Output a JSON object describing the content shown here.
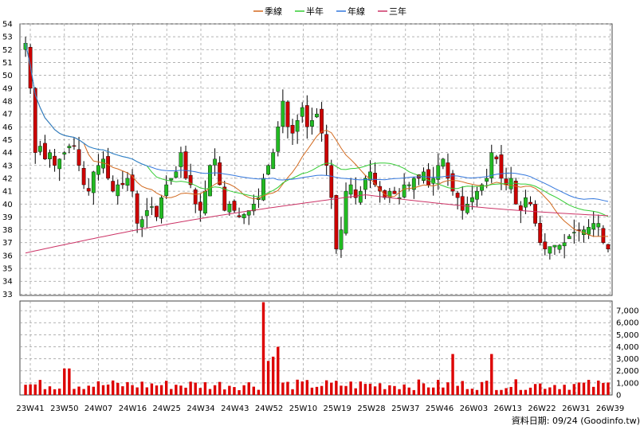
{
  "chart_data": {
    "type": "candlestick-with-volume",
    "legend": [
      {
        "label": "季線",
        "color": "#d2691e"
      },
      {
        "label": "半年",
        "color": "#33cc33"
      },
      {
        "label": "年線",
        "color": "#3377dd"
      },
      {
        "label": "三年",
        "color": "#cc3366"
      }
    ],
    "price_axis": {
      "ticks": [
        33,
        34,
        35,
        36,
        37,
        38,
        39,
        40,
        41,
        42,
        43,
        44,
        45,
        46,
        47,
        48,
        49,
        50,
        51,
        52,
        53,
        54
      ],
      "ylim": [
        32.9,
        54
      ]
    },
    "volume_axis": {
      "ticks": [
        "0",
        "1,000",
        "2,000",
        "3,000",
        "4,000",
        "5,000",
        "6,000",
        "7,000"
      ],
      "max": 7800
    },
    "x_tick_labels": [
      "23W41",
      "23W50",
      "24W07",
      "24W16",
      "24W25",
      "24W34",
      "24W43",
      "24W52",
      "25W10",
      "25W19",
      "25W28",
      "25W37",
      "25W46",
      "26W03",
      "26W13",
      "26W22",
      "26W31",
      "26W39"
    ],
    "colors": {
      "up": "#22bb22",
      "down": "#cc0000",
      "grid": "#999999",
      "volume": "#dd0000"
    },
    "footer": "資料日期: 09/24  (Goodinfo.tw)",
    "close": [
      52.5,
      49.0,
      44.0,
      44.5,
      43.5,
      44.0,
      43.0,
      43.5,
      44.0,
      44.5,
      44.5,
      43.0,
      41.5,
      41.0,
      42.5,
      43.0,
      43.5,
      42.0,
      41.0,
      41.5,
      41.5,
      42.0,
      41.0,
      38.5,
      38.8,
      39.5,
      39.8,
      39.0,
      40.5,
      41.5,
      42.0,
      42.5,
      44.0,
      42.0,
      41.5,
      40.0,
      39.5,
      41.0,
      43.0,
      43.5,
      41.5,
      39.5,
      40.0,
      39.5,
      39.0,
      39.2,
      39.5,
      40.0,
      40.5,
      42.0,
      43.0,
      44.0,
      46.0,
      48.0,
      46.0,
      45.5,
      46.5,
      47.5,
      46.0,
      46.5,
      47.0,
      45.5,
      43.0,
      40.5,
      36.5,
      38.0,
      41.0,
      41.5,
      40.5,
      41.0,
      42.0,
      42.5,
      41.5,
      41.0,
      40.5,
      41.0,
      40.8,
      40.5,
      41.5,
      41.5,
      42.0,
      42.0,
      42.5,
      41.5,
      42.0,
      43.0,
      43.5,
      42.0,
      41.0,
      40.5,
      39.5,
      40.0,
      40.5,
      41.0,
      41.5,
      42.0,
      44.0,
      43.5,
      42.0,
      41.5,
      42.0,
      40.0,
      39.5,
      40.5,
      40.0,
      38.5,
      37.0,
      36.5,
      36.7,
      36.8,
      36.8,
      37.0,
      37.5,
      37.8,
      38.0,
      38.0,
      38.2,
      38.5,
      38.5,
      37.0,
      36.5
    ]
  }
}
